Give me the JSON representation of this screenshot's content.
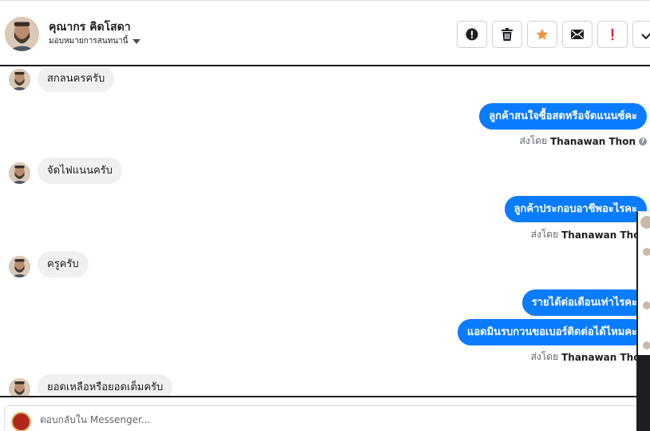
{
  "header": {
    "contact_name": "คุณากร คิดโสดา",
    "assign_label": "มอบหมายการสนทนานี้",
    "actions": [
      {
        "name": "spam-button",
        "icon": "alert-circle-icon"
      },
      {
        "name": "delete-button",
        "icon": "trash-icon"
      },
      {
        "name": "star-button",
        "icon": "star-icon"
      },
      {
        "name": "mark-unread-button",
        "icon": "envelope-icon"
      },
      {
        "name": "follow-up-button",
        "icon": "exclamation-icon"
      },
      {
        "name": "done-button",
        "icon": "check-icon"
      }
    ]
  },
  "messages": [
    {
      "dir": "in",
      "text": "สกลนครครับ"
    },
    {
      "dir": "out",
      "text": "ลูกค้าสนใจซื้อสดหรือจัดแนนซ์คะ"
    },
    {
      "sent_by_prefix": "ส่งโดย",
      "sent_by_name": "Thanawan Thon"
    },
    {
      "dir": "in",
      "text": "จัดไฟแนนครับ"
    },
    {
      "dir": "out",
      "text": "ลูกค้าประกอบอาชีพอะไรคะ"
    },
    {
      "sent_by_prefix": "ส่งโดย",
      "sent_by_name": "Thanawan Thon"
    },
    {
      "dir": "in",
      "text": "ครูครับ"
    },
    {
      "dir": "out",
      "text": "รายได้ต่อเดือนเท่าไรคะ"
    },
    {
      "dir": "out",
      "text": "แอดมินรบกวนขอเบอร์ติดต่อได้ไหมคะ"
    },
    {
      "sent_by_prefix": "ส่งโดย",
      "sent_by_name": "Thanawan Thon"
    },
    {
      "dir": "in",
      "text": "ยอดเหลือหรือยอดเต็มครับ"
    }
  ],
  "composer": {
    "placeholder": "ตอบกลับใน Messenger..."
  },
  "colors": {
    "outgoing_bubble": "#0a7cff",
    "incoming_bubble": "#f0f0f0",
    "star": "#f7923b",
    "alert": "#e41e3f"
  }
}
